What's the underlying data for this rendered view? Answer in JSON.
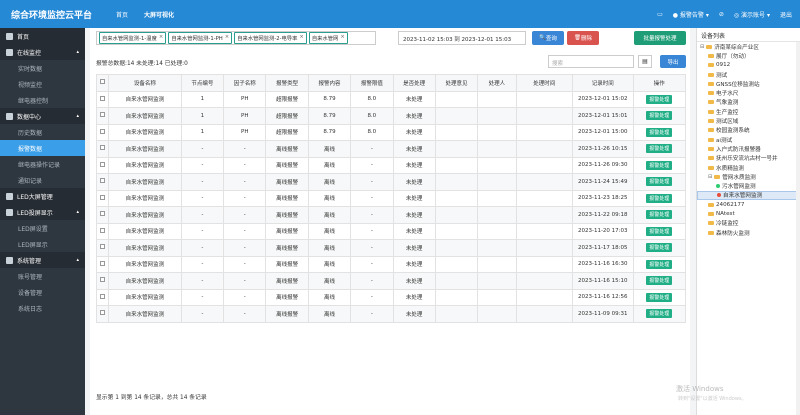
{
  "topbar": {
    "title": "综合环境监控云平台",
    "nav": [
      "首页",
      "大屏可视化"
    ],
    "right": {
      "alarm_label": "报警告警",
      "alarm_count": "",
      "user_label": "演示账号",
      "user_count": "",
      "logout": "退出"
    }
  },
  "sidebar": [
    {
      "label": "首页",
      "type": "group",
      "icon": "home-icon"
    },
    {
      "label": "在线监控",
      "type": "group",
      "icon": "monitor-icon"
    },
    {
      "label": "实时数据",
      "type": "sub"
    },
    {
      "label": "视频监控",
      "type": "sub"
    },
    {
      "label": "继电器控制",
      "type": "sub"
    },
    {
      "label": "数据中心",
      "type": "group",
      "icon": "data-icon"
    },
    {
      "label": "历史数据",
      "type": "sub"
    },
    {
      "label": "报警数据",
      "type": "sub",
      "active": true
    },
    {
      "label": "继电器操作记录",
      "type": "sub"
    },
    {
      "label": "通知记录",
      "type": "sub"
    },
    {
      "label": "LED大屏管理",
      "type": "group",
      "icon": "led-icon"
    },
    {
      "label": "LED投屏显示",
      "type": "group",
      "icon": "screen-icon"
    },
    {
      "label": "LED屏设置",
      "type": "sub"
    },
    {
      "label": "LED屏显示",
      "type": "sub"
    },
    {
      "label": "系统管理",
      "type": "group",
      "icon": "system-icon"
    },
    {
      "label": "账号管理",
      "type": "sub"
    },
    {
      "label": "设备管理",
      "type": "sub"
    },
    {
      "label": "系统日志",
      "type": "sub"
    }
  ],
  "filters": {
    "tags": [
      "自来水管网监测-1-温度",
      "自来水管网监测-1-PH",
      "自来水管网监测-2-电导率",
      "自来水管网"
    ],
    "date_range": "2023-11-02 15:03 到 2023-12-01 15:03",
    "query_label": "查询",
    "delete_label": "删除",
    "batch_label": "批量报警处理"
  },
  "summary": "报警总数据:14  未处理:14  已处理:0",
  "search_placeholder": "搜索",
  "export_label": "导出",
  "table": {
    "headers": [
      "",
      "设备名称",
      "节点编号",
      "因子名称",
      "报警类型",
      "报警内容",
      "报警限值",
      "是否处理",
      "处理意见",
      "处理人",
      "处理时间",
      "记录时间",
      "操作"
    ],
    "rows": [
      [
        "自来水管网监测",
        "1",
        "PH",
        "超限报警",
        "8.79",
        "8.0",
        "未处理",
        "",
        "",
        "",
        "2023-12-01 15:02"
      ],
      [
        "自来水管网监测",
        "1",
        "PH",
        "超限报警",
        "8.79",
        "8.0",
        "未处理",
        "",
        "",
        "",
        "2023-12-01 15:01"
      ],
      [
        "自来水管网监测",
        "1",
        "PH",
        "超限报警",
        "8.79",
        "8.0",
        "未处理",
        "",
        "",
        "",
        "2023-12-01 15:00"
      ],
      [
        "自来水管网监测",
        "-",
        "-",
        "离线报警",
        "离线",
        "-",
        "未处理",
        "",
        "",
        "",
        "2023-11-26 10:15"
      ],
      [
        "自来水管网监测",
        "-",
        "-",
        "离线报警",
        "离线",
        "-",
        "未处理",
        "",
        "",
        "",
        "2023-11-26 09:30"
      ],
      [
        "自来水管网监测",
        "-",
        "-",
        "离线报警",
        "离线",
        "-",
        "未处理",
        "",
        "",
        "",
        "2023-11-24 15:49"
      ],
      [
        "自来水管网监测",
        "-",
        "-",
        "离线报警",
        "离线",
        "-",
        "未处理",
        "",
        "",
        "",
        "2023-11-23 18:25"
      ],
      [
        "自来水管网监测",
        "-",
        "-",
        "离线报警",
        "离线",
        "-",
        "未处理",
        "",
        "",
        "",
        "2023-11-22 09:18"
      ],
      [
        "自来水管网监测",
        "-",
        "-",
        "离线报警",
        "离线",
        "-",
        "未处理",
        "",
        "",
        "",
        "2023-11-20 17:03"
      ],
      [
        "自来水管网监测",
        "-",
        "-",
        "离线报警",
        "离线",
        "-",
        "未处理",
        "",
        "",
        "",
        "2023-11-17 18:05"
      ],
      [
        "自来水管网监测",
        "-",
        "-",
        "离线报警",
        "离线",
        "-",
        "未处理",
        "",
        "",
        "",
        "2023-11-16 16:30"
      ],
      [
        "自来水管网监测",
        "-",
        "-",
        "离线报警",
        "离线",
        "-",
        "未处理",
        "",
        "",
        "",
        "2023-11-16 15:10"
      ],
      [
        "自来水管网监测",
        "-",
        "-",
        "离线报警",
        "离线",
        "-",
        "未处理",
        "",
        "",
        "",
        "2023-11-16 12:56"
      ],
      [
        "自来水管网监测",
        "-",
        "-",
        "离线报警",
        "离线",
        "-",
        "未处理",
        "",
        "",
        "",
        "2023-11-09 09:31"
      ]
    ],
    "action_label": "报警处理"
  },
  "footer": "显示第 1 到第 14 条记录，总共 14 条记录",
  "device_list": {
    "title": "设备列表",
    "items": [
      {
        "label": "济南某综合产业区",
        "level": 0,
        "kind": "folder"
      },
      {
        "label": "展厅（勿动）",
        "level": 1,
        "kind": "folder"
      },
      {
        "label": "0912",
        "level": 1,
        "kind": "folder"
      },
      {
        "label": "测试",
        "level": 1,
        "kind": "folder"
      },
      {
        "label": "GNSS位移监测站",
        "level": 1,
        "kind": "folder"
      },
      {
        "label": "电子水尺",
        "level": 1,
        "kind": "folder"
      },
      {
        "label": "气象监测",
        "level": 1,
        "kind": "folder"
      },
      {
        "label": "生产监控",
        "level": 1,
        "kind": "folder"
      },
      {
        "label": "测试区域",
        "level": 1,
        "kind": "folder"
      },
      {
        "label": "校园监测系统",
        "level": 1,
        "kind": "folder"
      },
      {
        "label": "ai测试",
        "level": 1,
        "kind": "folder"
      },
      {
        "label": "入户式防汛报警器",
        "level": 1,
        "kind": "folder"
      },
      {
        "label": "抚州乐安流坑古村一号井",
        "level": 1,
        "kind": "folder"
      },
      {
        "label": "水质精监测",
        "level": 1,
        "kind": "folder"
      },
      {
        "label": "管网水质监测",
        "level": 1,
        "kind": "folder"
      },
      {
        "label": "污水管网监测",
        "level": 2,
        "kind": "green"
      },
      {
        "label": "自来水管网监测",
        "level": 2,
        "kind": "red",
        "selected": true
      },
      {
        "label": "24062177",
        "level": 1,
        "kind": "folder"
      },
      {
        "label": "NAtest",
        "level": 1,
        "kind": "folder"
      },
      {
        "label": "冷链监控",
        "level": 1,
        "kind": "folder"
      },
      {
        "label": "森林防火监测",
        "level": 1,
        "kind": "folder"
      }
    ]
  },
  "watermark": {
    "line1": "激活 Windows",
    "line2": "转到\"设置\"以激活 Windows。"
  }
}
